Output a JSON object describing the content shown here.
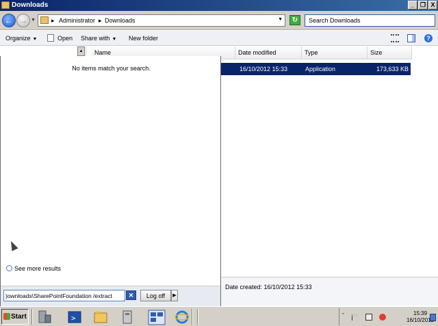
{
  "window": {
    "title": "Downloads",
    "minimize": "_",
    "maximize": "❐",
    "close": "X"
  },
  "address": {
    "crumbs": [
      "Administrator",
      "Downloads"
    ],
    "search_placeholder": "Search Downloads"
  },
  "toolbar": {
    "organize": "Organize",
    "open": "Open",
    "share_with": "Share with",
    "new_folder": "New folder"
  },
  "columns": [
    "Name",
    "Date modified",
    "Type",
    "Size"
  ],
  "file": {
    "date_modified": "16/10/2012 15:33",
    "type": "Application",
    "size": "173,633 KB"
  },
  "details": {
    "date_created": "Date created: 16/10/2012 15:33"
  },
  "start_menu": {
    "no_items": "No items match your search.",
    "see_more": "See more results",
    "search_text": ")ownloads\\SharePointFoundation /extract",
    "log_off": "Log off"
  },
  "taskbar": {
    "start": "Start",
    "time": "15:39",
    "date": "16/10/2012"
  },
  "colors": {
    "selection": "#0a246a",
    "titlebar": "#0a246a",
    "taskbar": "#d4d0c8"
  }
}
